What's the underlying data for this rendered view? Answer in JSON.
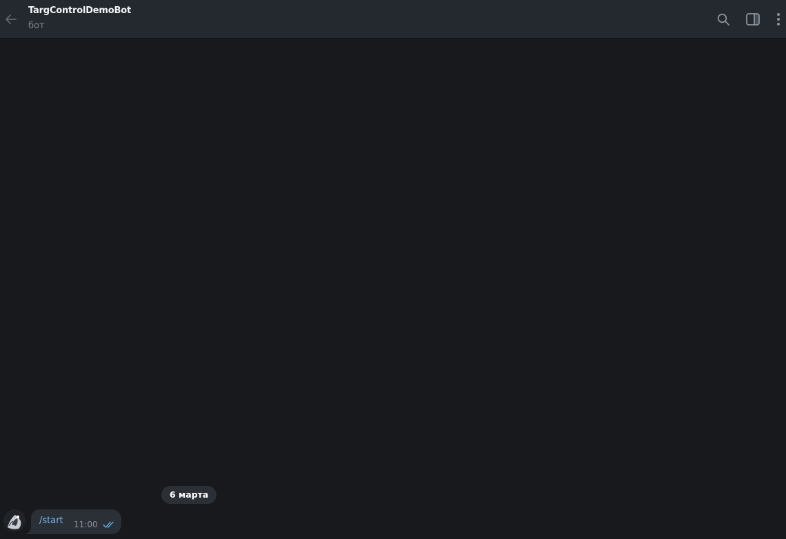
{
  "header": {
    "title": "TargControlDemoBot",
    "subtitle": "бот",
    "icons": [
      "back-arrow-icon",
      "search-icon",
      "side-panel-icon",
      "more-vertical-icon"
    ]
  },
  "chat": {
    "date_label": "6 марта",
    "messages": [
      {
        "text": "/start",
        "time": "11:00",
        "status_icon": "double-check-icon"
      }
    ]
  },
  "colors": {
    "header_bg": "#242930",
    "chat_bg": "#18191d",
    "bubble_bg": "#2b2f36",
    "command_text": "#76b9ee",
    "check_color": "#5aa7e0"
  }
}
